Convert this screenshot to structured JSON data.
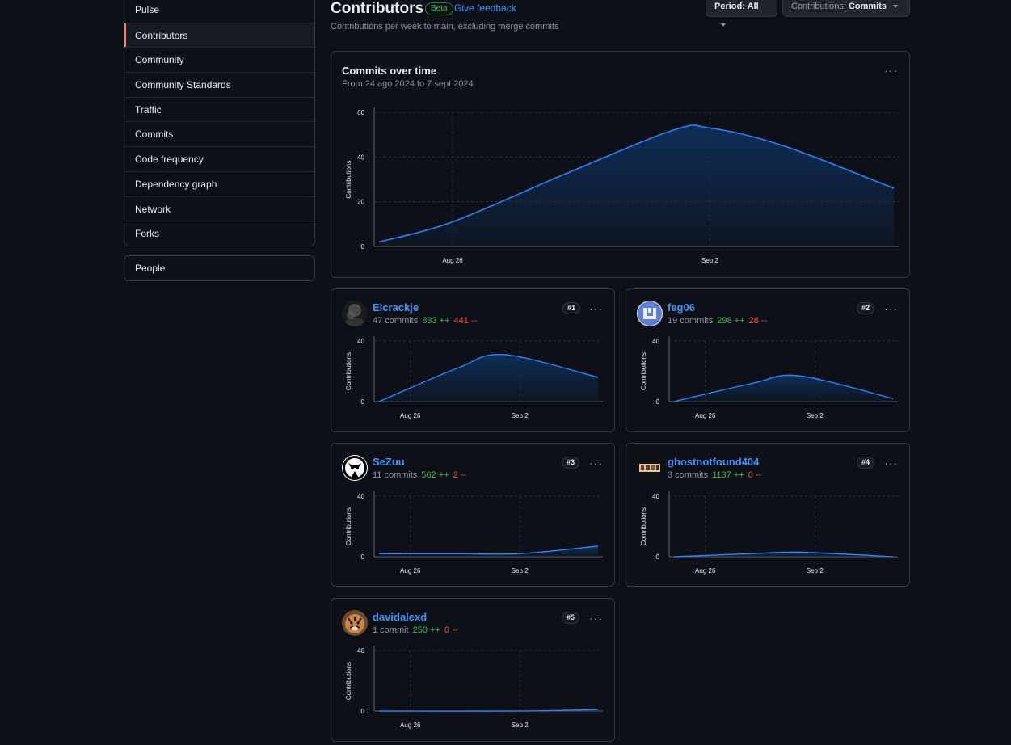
{
  "sidebar": {
    "items": [
      {
        "label": "Pulse"
      },
      {
        "label": "Contributors",
        "active": true
      },
      {
        "label": "Community"
      },
      {
        "label": "Community Standards"
      },
      {
        "label": "Traffic"
      },
      {
        "label": "Commits"
      },
      {
        "label": "Code frequency"
      },
      {
        "label": "Dependency graph"
      },
      {
        "label": "Network"
      },
      {
        "label": "Forks"
      }
    ],
    "people_label": "People"
  },
  "header": {
    "title": "Contributors",
    "beta_label": "Beta",
    "feedback_label": "Give feedback",
    "subtitle": "Contributions per week to main, excluding merge commits",
    "period_prefix": "Period:",
    "period_value": "All",
    "contrib_prefix": "Contributions:",
    "contrib_value": "Commits"
  },
  "main_card": {
    "title": "Commits over time",
    "subtitle": "From 24 ago 2024 to 7 sept 2024",
    "menu_label": "···"
  },
  "colors": {
    "accent": "#4493f8",
    "line": "#2f81f7",
    "fill": "#0f2e58",
    "additions": "#3fb950",
    "deletions": "#f85149",
    "active_nav": "#f78166"
  },
  "chart_data": [
    {
      "type": "area",
      "chart": "Commits over time",
      "x": [
        "2024-08-24",
        "2024-08-26",
        "2024-08-29",
        "2024-09-01",
        "2024-09-02",
        "2024-09-04",
        "2024-09-07"
      ],
      "series": [
        {
          "values": [
            2,
            11,
            32,
            52,
            53,
            45,
            26
          ]
        }
      ],
      "xticks": [
        "Aug 26",
        "Sep 2"
      ],
      "yticks": [
        0,
        20,
        40,
        60
      ],
      "ylabel": "Contributions",
      "ylim": [
        0,
        60
      ],
      "grid": true
    },
    {
      "type": "area",
      "chart": "Elcrackje",
      "x": [
        "2024-08-24",
        "2024-08-29",
        "2024-09-01",
        "2024-09-07"
      ],
      "series": [
        {
          "values": [
            0,
            22,
            31,
            16
          ]
        }
      ],
      "xticks": [
        "Aug 26",
        "Sep 2"
      ],
      "yticks": [
        0,
        40
      ],
      "ylabel": "Contributions",
      "ylim": [
        0,
        40
      ]
    },
    {
      "type": "area",
      "chart": "feg06",
      "x": [
        "2024-08-24",
        "2024-08-29",
        "2024-09-01",
        "2024-09-07"
      ],
      "series": [
        {
          "values": [
            0,
            12,
            17,
            2
          ]
        }
      ],
      "xticks": [
        "Aug 26",
        "Sep 2"
      ],
      "yticks": [
        0,
        40
      ],
      "ylabel": "Contributions",
      "ylim": [
        0,
        40
      ]
    },
    {
      "type": "area",
      "chart": "SeZuu",
      "x": [
        "2024-08-24",
        "2024-08-29",
        "2024-09-02",
        "2024-09-07"
      ],
      "series": [
        {
          "values": [
            2,
            2,
            2,
            7
          ]
        }
      ],
      "xticks": [
        "Aug 26",
        "Sep 2"
      ],
      "yticks": [
        0,
        40
      ],
      "ylabel": "Contributions",
      "ylim": [
        0,
        40
      ]
    },
    {
      "type": "area",
      "chart": "ghostnotfound404",
      "x": [
        "2024-08-24",
        "2024-08-29",
        "2024-09-01",
        "2024-09-07"
      ],
      "series": [
        {
          "values": [
            0,
            2,
            3,
            0
          ]
        }
      ],
      "xticks": [
        "Aug 26",
        "Sep 2"
      ],
      "yticks": [
        0,
        40
      ],
      "ylabel": "Contributions",
      "ylim": [
        0,
        40
      ]
    },
    {
      "type": "area",
      "chart": "davidalexd",
      "x": [
        "2024-08-24",
        "2024-09-02",
        "2024-09-07"
      ],
      "series": [
        {
          "values": [
            0,
            0,
            1
          ]
        }
      ],
      "xticks": [
        "Aug 26",
        "Sep 2"
      ],
      "yticks": [
        0,
        40
      ],
      "ylabel": "Contributions",
      "ylim": [
        0,
        40
      ]
    }
  ],
  "contributors": [
    {
      "name": "Elcrackje",
      "commits": "47 commits",
      "additions": "833 ++",
      "deletions": "441 --",
      "rank": "#1",
      "avatar": "dark-photo"
    },
    {
      "name": "feg06",
      "commits": "19 commits",
      "additions": "298 ++",
      "deletions": "28 --",
      "rank": "#2",
      "avatar": "blue-identicon"
    },
    {
      "name": "SeZuu",
      "commits": "11 commits",
      "additions": "562 ++",
      "deletions": "2 --",
      "rank": "#3",
      "avatar": "black-white-logo"
    },
    {
      "name": "ghostnotfound404",
      "commits": "3 commits",
      "additions": "1137 ++",
      "deletions": "0 --",
      "rank": "#4",
      "avatar": "banner-image"
    },
    {
      "name": "davidalexd",
      "commits": "1 commit",
      "additions": "250 ++",
      "deletions": "0 --",
      "rank": "#5",
      "avatar": "tiger-photo"
    }
  ]
}
